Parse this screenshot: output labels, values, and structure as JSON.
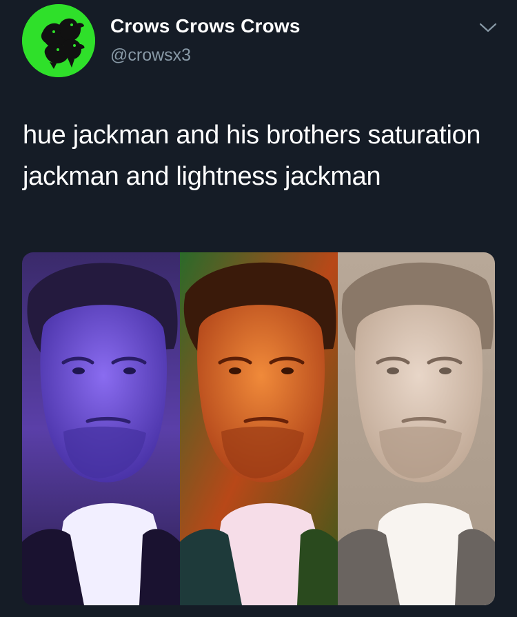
{
  "tweet": {
    "author": {
      "display_name": "Crows Crows Crows",
      "handle": "@crowsx3",
      "avatar_icon": "crows-avatar-icon"
    },
    "menu_icon": "chevron-down-icon",
    "text": "hue jackman and his brothers saturation jackman and lightness jackman",
    "media": {
      "panels": [
        {
          "tint": "hue",
          "color": "#6a4fd6"
        },
        {
          "tint": "saturation",
          "color": "#e0702a"
        },
        {
          "tint": "lightness",
          "color": "#c9b8a8"
        }
      ]
    }
  },
  "colors": {
    "background": "#151c26",
    "avatar_bg": "#2fe02a",
    "handle": "#8899a6"
  }
}
